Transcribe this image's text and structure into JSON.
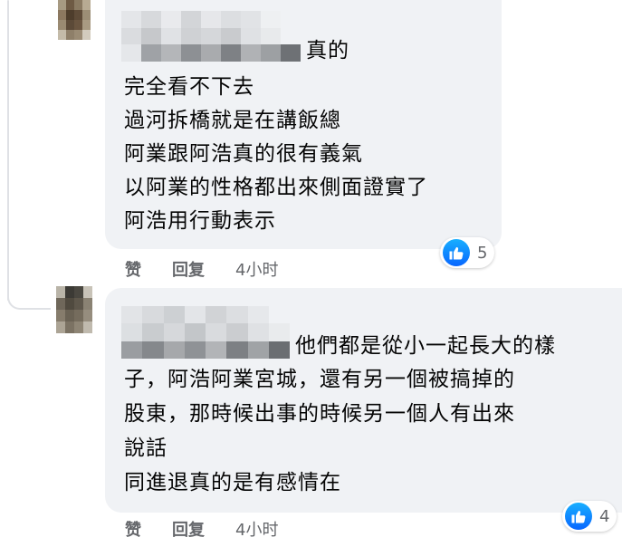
{
  "comments": [
    {
      "name_blurred": true,
      "text_after_name": "真的",
      "lines": [
        "完全看不下去",
        "過河拆橋就是在講飯總",
        "阿業跟阿浩真的很有義氣",
        "以阿業的性格都出來側面證實了",
        "阿浩用行動表示"
      ],
      "reaction": {
        "icon": "like-icon",
        "count": "5"
      },
      "actions": {
        "like": "赞",
        "reply": "回复",
        "time": "4小时"
      }
    },
    {
      "name_blurred": true,
      "text_after_name": "他們都是從小一起長大的樣",
      "lines": [
        "子，阿浩阿業宮城，還有另一個被搞掉的",
        "股東，那時候出事的時候另一個人有出來",
        "說話",
        "同進退真的是有感情在"
      ],
      "reaction": {
        "icon": "like-icon",
        "count": "4"
      },
      "actions": {
        "like": "赞",
        "reply": "回复",
        "time": "4小时"
      }
    }
  ],
  "colors": {
    "bubble": "#f0f2f5",
    "text": "#050505",
    "secondary": "#65676b",
    "like_blue": "#0866ff",
    "thread_line": "#dfe1e5"
  }
}
